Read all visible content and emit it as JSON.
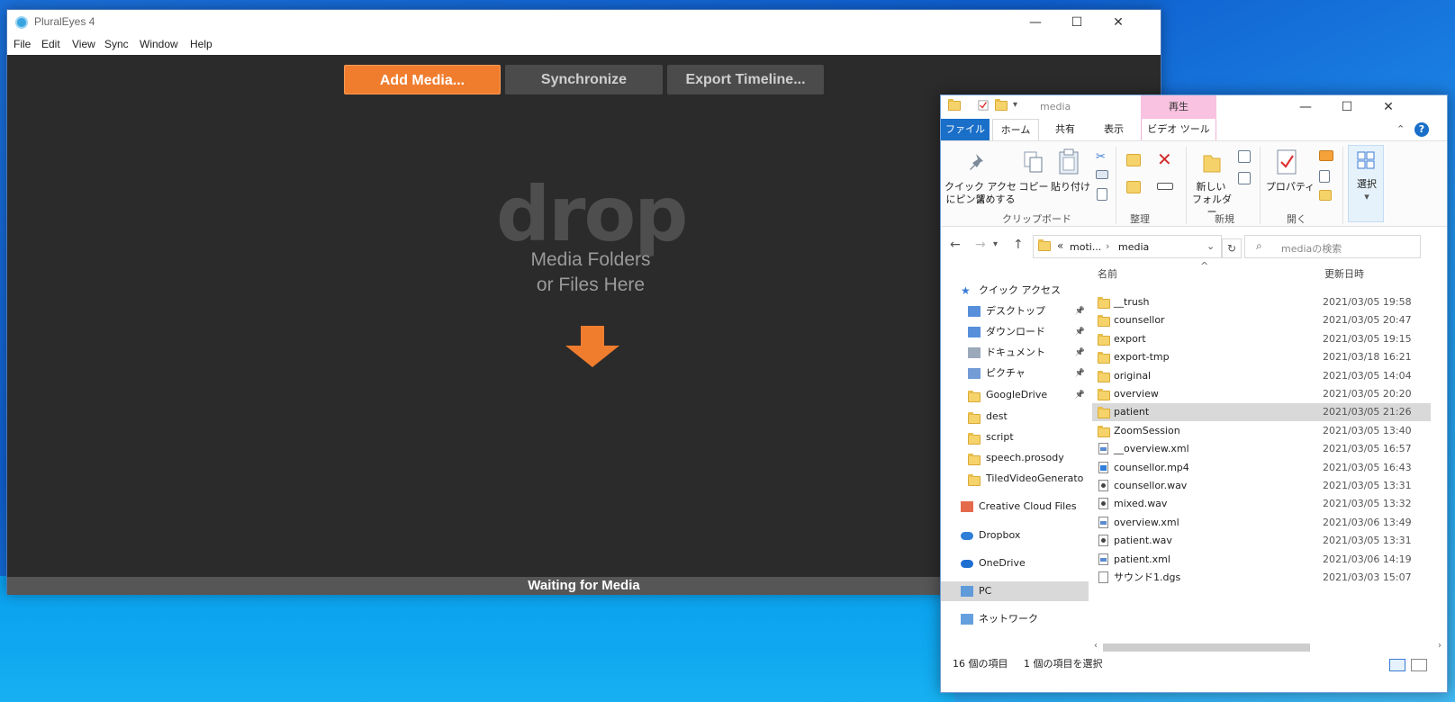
{
  "pluraleyes": {
    "title": "PluralEyes 4",
    "menu": [
      "File",
      "Edit",
      "View",
      "Sync",
      "Window",
      "Help"
    ],
    "buttons": {
      "add_media": "Add Media...",
      "synchronize": "Synchronize",
      "export_timeline": "Export Timeline..."
    },
    "drop": {
      "word": "drop",
      "line1": "Media Folders",
      "line2": "or Files Here"
    },
    "status": "Waiting for Media",
    "colors": {
      "accent": "#f07d2e",
      "bg": "#2b2b2b",
      "button_inactive": "#4b4b4b"
    }
  },
  "window_controls": {
    "minimize": "—",
    "maximize": "☐",
    "close": "✕"
  },
  "explorer": {
    "title": "media",
    "context_tab_header": "再生",
    "tabs": {
      "file": "ファイル",
      "home": "ホーム",
      "share": "共有",
      "view": "表示",
      "video_tools": "ビデオ ツール"
    },
    "ribbon": {
      "pin_quick_access_1": "クイック アクセス",
      "pin_quick_access_2": "にピン留めする",
      "copy": "コピー",
      "paste": "貼り付け",
      "new_folder_1": "新しい",
      "new_folder_2": "フォルダー",
      "properties": "プロパティ",
      "select": "選択",
      "groups": {
        "clipboard": "クリップボード",
        "organize": "整理",
        "new": "新規",
        "open": "開く"
      }
    },
    "address": {
      "prefix": "«",
      "crumb1": "moti...",
      "separator": "›",
      "crumb2": "media",
      "search_placeholder": "mediaの検索"
    },
    "nav": [
      {
        "label": "クイック アクセス",
        "icon": "star-icon"
      },
      {
        "label": "デスクトップ",
        "icon": "desktop-icon",
        "pinned": true
      },
      {
        "label": "ダウンロード",
        "icon": "download-icon",
        "pinned": true
      },
      {
        "label": "ドキュメント",
        "icon": "documents-icon",
        "pinned": true
      },
      {
        "label": "ピクチャ",
        "icon": "pictures-icon",
        "pinned": true
      },
      {
        "label": "GoogleDrive",
        "icon": "folder-icon",
        "pinned": true
      },
      {
        "label": "dest",
        "icon": "folder-icon"
      },
      {
        "label": "script",
        "icon": "folder-icon"
      },
      {
        "label": "speech.prosody",
        "icon": "folder-icon"
      },
      {
        "label": "TiledVideoGenerato",
        "icon": "folder-icon"
      },
      {
        "label": "Creative Cloud Files",
        "icon": "creative-cloud-icon"
      },
      {
        "label": "Dropbox",
        "icon": "dropbox-icon"
      },
      {
        "label": "OneDrive",
        "icon": "onedrive-icon"
      },
      {
        "label": "PC",
        "icon": "pc-icon",
        "selected": true
      },
      {
        "label": "ネットワーク",
        "icon": "network-icon"
      }
    ],
    "columns": {
      "name": "名前",
      "date": "更新日時"
    },
    "files": [
      {
        "name": "__trush",
        "date": "2021/03/05 19:58",
        "type": "folder"
      },
      {
        "name": "counsellor",
        "date": "2021/03/05 20:47",
        "type": "folder"
      },
      {
        "name": "export",
        "date": "2021/03/05 19:15",
        "type": "folder"
      },
      {
        "name": "export-tmp",
        "date": "2021/03/18 16:21",
        "type": "folder"
      },
      {
        "name": "original",
        "date": "2021/03/05 14:04",
        "type": "folder"
      },
      {
        "name": "overview",
        "date": "2021/03/05 20:20",
        "type": "folder"
      },
      {
        "name": "patient",
        "date": "2021/03/05 21:26",
        "type": "folder",
        "selected": true
      },
      {
        "name": "ZoomSession",
        "date": "2021/03/05 13:40",
        "type": "folder"
      },
      {
        "name": "__overview.xml",
        "date": "2021/03/05 16:57",
        "type": "xml"
      },
      {
        "name": "counsellor.mp4",
        "date": "2021/03/05 16:43",
        "type": "mp4"
      },
      {
        "name": "counsellor.wav",
        "date": "2021/03/05 13:31",
        "type": "media"
      },
      {
        "name": "mixed.wav",
        "date": "2021/03/05 13:32",
        "type": "media"
      },
      {
        "name": "overview.xml",
        "date": "2021/03/06 13:49",
        "type": "xml"
      },
      {
        "name": "patient.wav",
        "date": "2021/03/05 13:31",
        "type": "media"
      },
      {
        "name": "patient.xml",
        "date": "2021/03/06 14:19",
        "type": "xml"
      },
      {
        "name": "サウンド1.dgs",
        "date": "2021/03/03 15:07",
        "type": "file"
      }
    ],
    "status": {
      "count": "16 個の項目",
      "selected": "1 個の項目を選択"
    }
  }
}
